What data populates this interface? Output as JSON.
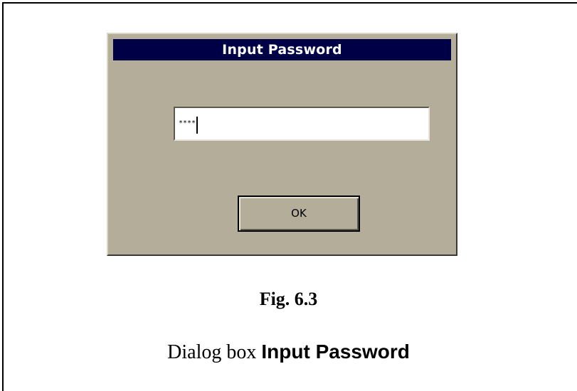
{
  "dialog": {
    "title": "Input Password",
    "password_value": "****",
    "ok_label": "OK"
  },
  "figure": {
    "label": "Fig. 6.3",
    "caption_prefix": "Dialog box ",
    "caption_bold": "Input Password"
  }
}
